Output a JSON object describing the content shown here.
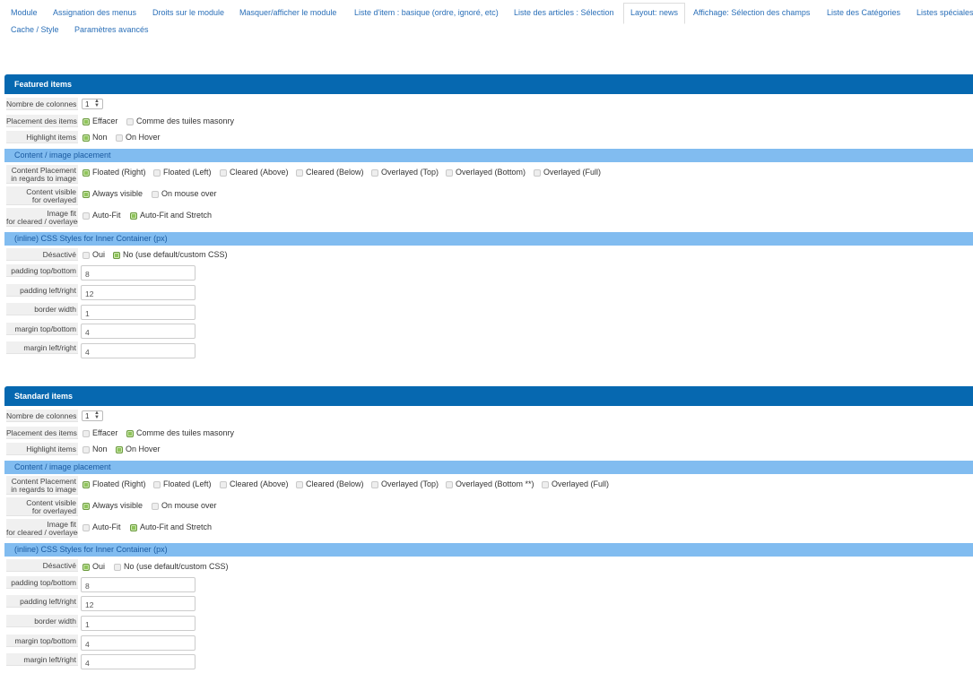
{
  "tabs": [
    {
      "label": "Module"
    },
    {
      "label": "Assignation des menus"
    },
    {
      "label": "Droits sur le module"
    },
    {
      "label": "Masquer/afficher le module"
    },
    {
      "label": "Liste d'item : basique (ordre, ignoré, etc)"
    },
    {
      "label": "Liste des articles : Sélection"
    },
    {
      "label": "Layout: news"
    },
    {
      "label": "Affichage: Sélection des champs"
    },
    {
      "label": "Liste des Catégories"
    },
    {
      "label": "Listes spéciales"
    },
    {
      "label": "Cache / Style"
    },
    {
      "label": "Paramètres avancés"
    }
  ],
  "active_tab": "Layout: news",
  "featured": {
    "title": "Featured items",
    "columns_label": "Nombre de colonnes",
    "columns_value": "1",
    "placement_label": "Placement des items",
    "placement_opts": [
      "Effacer",
      "Comme des tuiles masonry"
    ],
    "highlight_label": "Highlight items",
    "highlight_opts": [
      "Non",
      "On Hover"
    ],
    "content_bar": "Content / image placement",
    "cp_label1": "Content Placement",
    "cp_label2": "in regards to image",
    "cp_opts": [
      "Floated (Right)",
      "Floated (Left)",
      "Cleared (Above)",
      "Cleared (Below)",
      "Overlayed (Top)",
      "Overlayed (Bottom)",
      "Overlayed (Full)"
    ],
    "cv_label1": "Content visible",
    "cv_label2": "for overlayed",
    "cv_opts": [
      "Always visible",
      "On mouse over"
    ],
    "if_label1": "Image fit",
    "if_label2": "for cleared / overlayed",
    "if_opts": [
      "Auto-Fit",
      "Auto-Fit and Stretch"
    ],
    "css_bar": "(inline) CSS Styles for Inner Container (px)",
    "dis_label": "Désactivé",
    "dis_opts": [
      "Oui",
      "No (use default/custom CSS)"
    ],
    "f1_label": "padding top/bottom",
    "f1_value": "8",
    "f2_label": "padding left/right",
    "f2_value": "12",
    "f3_label": "border width",
    "f3_value": "1",
    "f4_label": "margin top/bottom",
    "f4_value": "4",
    "f5_label": "margin left/right",
    "f5_value": "4"
  },
  "standard": {
    "title": "Standard items",
    "columns_label": "Nombre de colonnes",
    "columns_value": "1",
    "placement_label": "Placement des items",
    "placement_opts": [
      "Effacer",
      "Comme des tuiles masonry"
    ],
    "highlight_label": "Highlight items",
    "highlight_opts": [
      "Non",
      "On Hover"
    ],
    "content_bar": "Content / image placement",
    "cp_label1": "Content Placement",
    "cp_label2": "in regards to image",
    "cp_opts": [
      "Floated (Right)",
      "Floated (Left)",
      "Cleared (Above)",
      "Cleared (Below)",
      "Overlayed (Top)",
      "Overlayed (Bottom **)",
      "Overlayed (Full)"
    ],
    "cv_label1": "Content visible",
    "cv_label2": "for overlayed",
    "cv_opts": [
      "Always visible",
      "On mouse over"
    ],
    "if_label1": "Image fit",
    "if_label2": "for cleared / overlayed",
    "if_opts": [
      "Auto-Fit",
      "Auto-Fit and Stretch"
    ],
    "css_bar": "(inline) CSS Styles for Inner Container (px)",
    "dis_label": "Désactivé",
    "dis_opts": [
      "Oui",
      "No (use default/custom CSS)"
    ],
    "f1_label": "padding top/bottom",
    "f1_value": "8",
    "f2_label": "padding left/right",
    "f2_value": "12",
    "f3_label": "border width",
    "f3_value": "1",
    "f4_label": "margin top/bottom",
    "f4_value": "4",
    "f5_label": "margin left/right",
    "f5_value": "4"
  },
  "colors": {
    "section": "#0668b0",
    "subsection": "#81bcf0",
    "checked": "#8fc45a",
    "link": "#2a6fb8"
  }
}
